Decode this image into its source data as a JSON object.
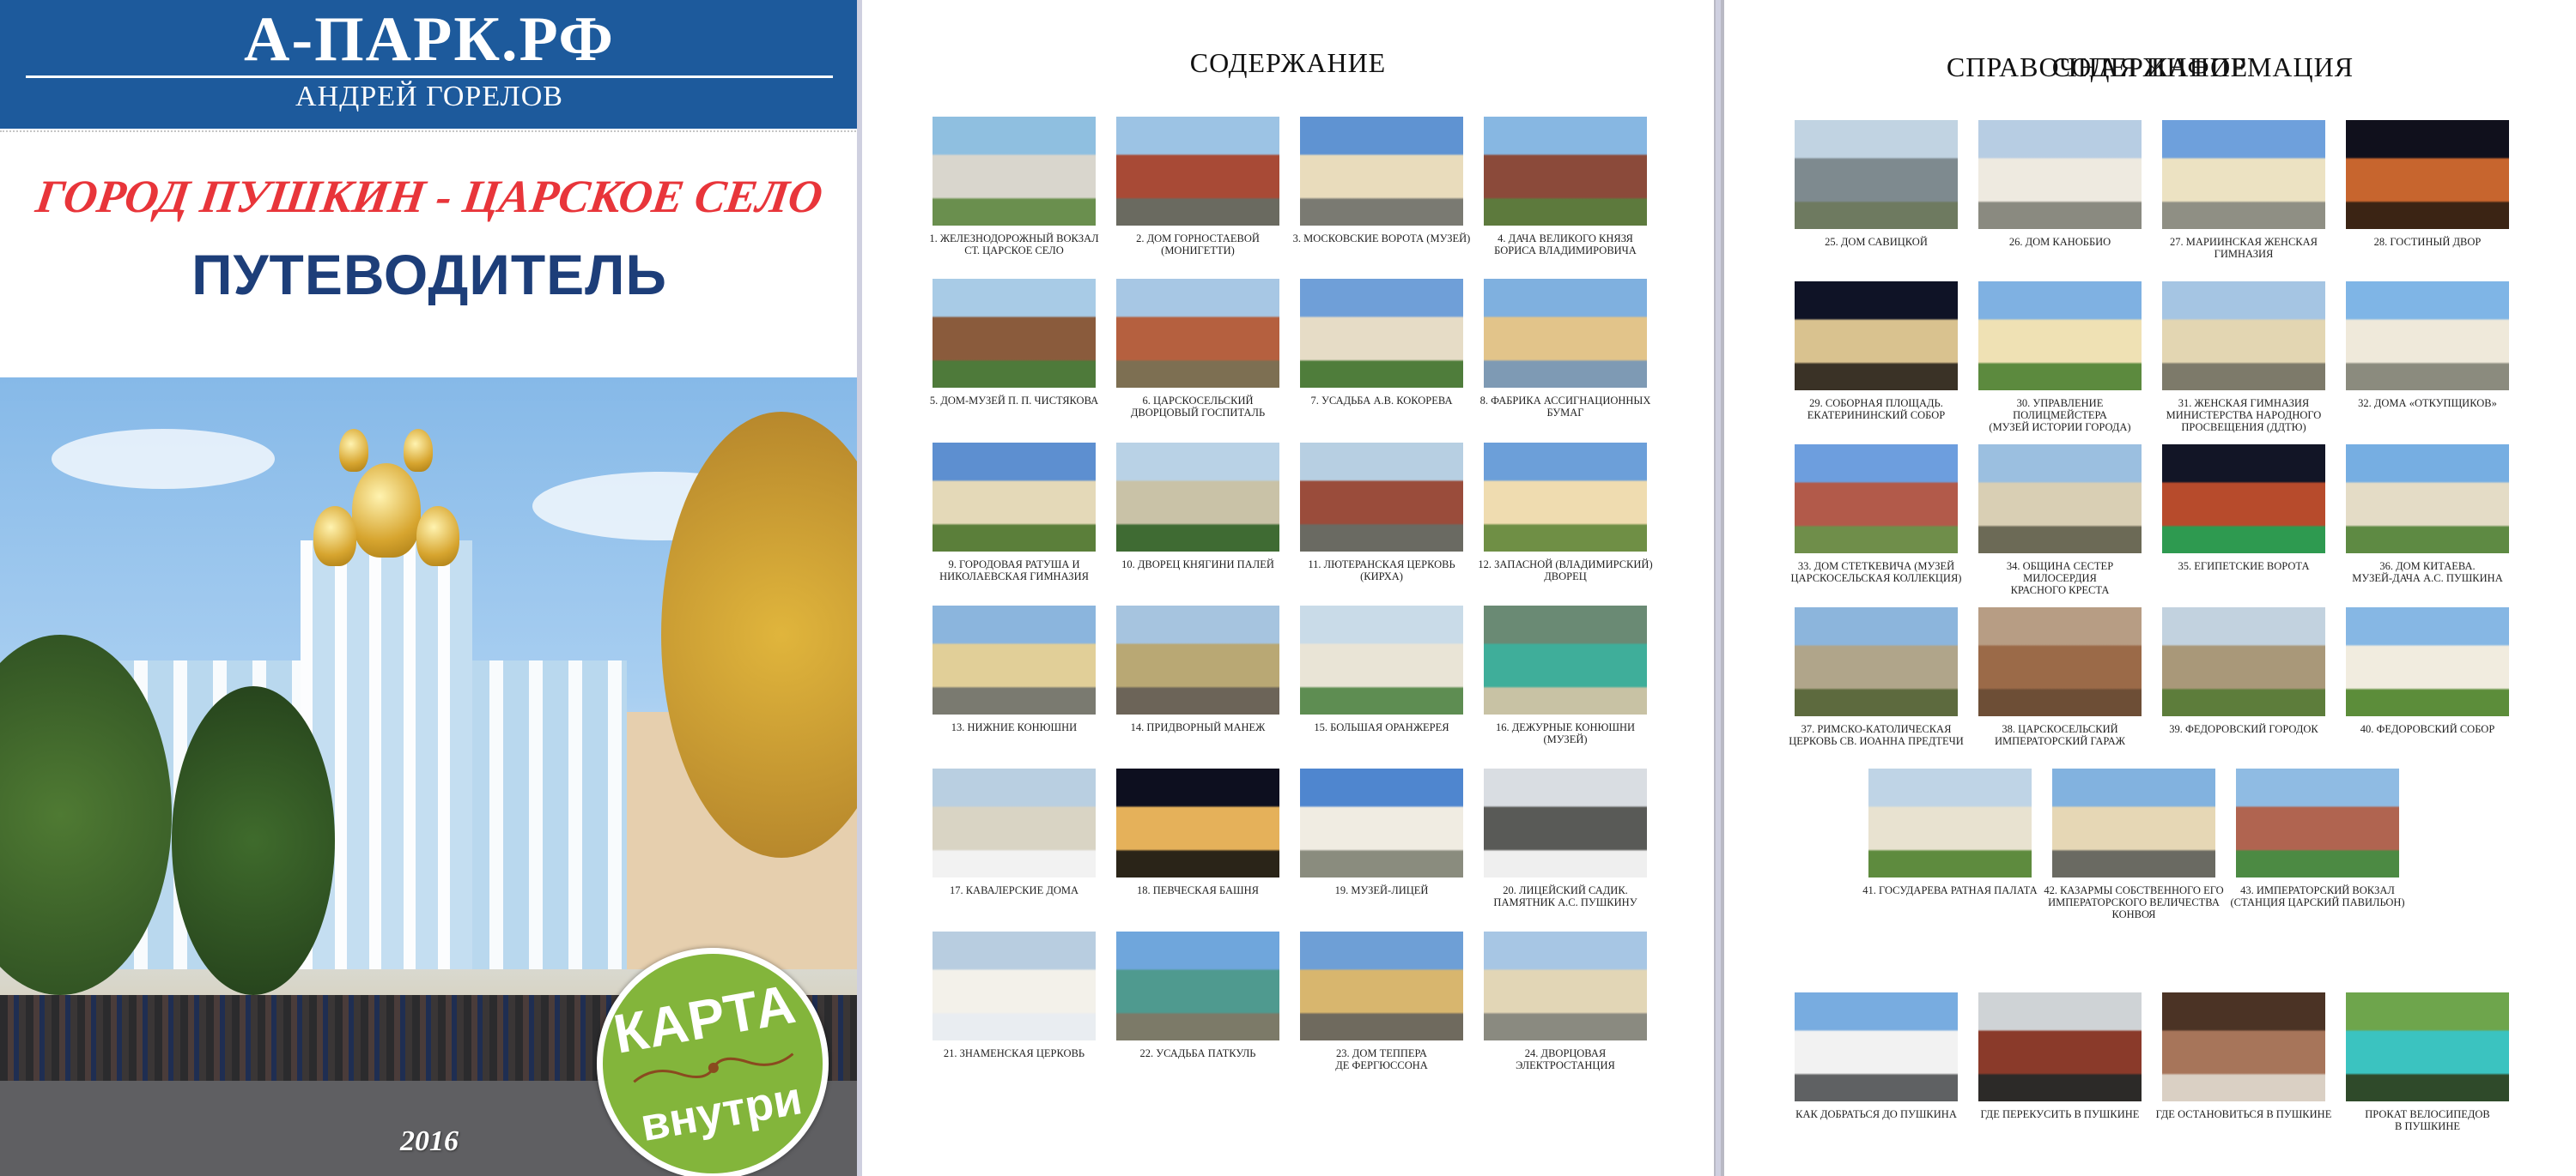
{
  "cover": {
    "site_name": "А-ПАРК.РФ",
    "author": "АНДРЕЙ ГОРЕЛОВ",
    "subtitle": "ГОРОД ПУШКИН - ЦАРСКОЕ СЕЛО",
    "title": "ПУТЕВОДИТЕЛЬ",
    "badge_top": "КАРТА",
    "badge_bottom": "внутри",
    "year": "2016"
  },
  "contents_title": "СОДЕРЖАНИЕ",
  "reference_title": "СПРАВОЧНАЯ ИНФОРМАЦИЯ",
  "page1_items": [
    {
      "caption": "1. ЖЕЛЕЗНОДОРОЖНЫЙ ВОКЗАЛ\nСТ. ЦАРСКОЕ СЕЛО",
      "colors": [
        "#8fbfe0",
        "#d9d6cd",
        "#6a8f4e"
      ]
    },
    {
      "caption": "2. ДОМ ГОРНОСТАЕВОЙ\n(МОНИГЕТТИ)",
      "colors": [
        "#9cc3e4",
        "#a84a36",
        "#6a6a60"
      ]
    },
    {
      "caption": "3. МОСКОВСКИЕ ВОРОТА (МУЗЕЙ)",
      "colors": [
        "#5f93d2",
        "#e9dcbc",
        "#7a7a72"
      ]
    },
    {
      "caption": "4. ДАЧА ВЕЛИКОГО КНЯЗЯ\nБОРИСА ВЛАДИМИРОВИЧА",
      "colors": [
        "#87b7e2",
        "#8b4a3a",
        "#5d7a3d"
      ]
    },
    {
      "caption": "5. ДОМ-МУЗЕЙ П. П. ЧИСТЯКОВА",
      "colors": [
        "#a8cbe6",
        "#8a5b3c",
        "#4e7a3a"
      ]
    },
    {
      "caption": "6. ЦАРСКОСЕЛЬСКИЙ\nДВОРЦОВЫЙ ГОСПИТАЛЬ",
      "colors": [
        "#a7c7e4",
        "#b5603f",
        "#7d6f52"
      ]
    },
    {
      "caption": "7. УСАДЬБА А.В. КОКОРЕВА",
      "colors": [
        "#6f9fd8",
        "#e6dcc6",
        "#4f7d3b"
      ]
    },
    {
      "caption": "8. ФАБРИКА АССИГНАЦИОННЫХ\nБУМАГ",
      "colors": [
        "#7fb0df",
        "#e2c48a",
        "#7e9ab4"
      ]
    },
    {
      "caption": "9. ГОРОДОВАЯ РАТУША И\nНИКОЛАЕВСКАЯ ГИМНАЗИЯ",
      "colors": [
        "#5d8fd0",
        "#e4d9b8",
        "#5b7f3a"
      ]
    },
    {
      "caption": "10. ДВОРЕЦ КНЯГИНИ ПАЛЕЙ",
      "colors": [
        "#b9d2e6",
        "#c9c2a7",
        "#3f6b33"
      ]
    },
    {
      "caption": "11. ЛЮТЕРАНСКАЯ ЦЕРКОВЬ\n(КИРХА)",
      "colors": [
        "#b7cfe2",
        "#9a4c3b",
        "#6a6a62"
      ]
    },
    {
      "caption": "12. ЗАПАСНОЙ (ВЛАДИМИРСКИЙ)\nДВОРЕЦ",
      "colors": [
        "#6c9fd9",
        "#efdcb0",
        "#6f8f45"
      ]
    },
    {
      "caption": "13. НИЖНИЕ КОНЮШНИ",
      "colors": [
        "#8bb5dd",
        "#e1cf98",
        "#7a7a70"
      ]
    },
    {
      "caption": "14. ПРИДВОРНЫЙ МАНЕЖ",
      "colors": [
        "#a6c4df",
        "#b9a874",
        "#6c6458"
      ]
    },
    {
      "caption": "15. БОЛЬШАЯ ОРАНЖЕРЕЯ",
      "colors": [
        "#c9dbe8",
        "#e9e4d6",
        "#5e8d52"
      ]
    },
    {
      "caption": "16. ДЕЖУРНЫЕ КОНЮШНИ\n(МУЗЕЙ)",
      "colors": [
        "#6a8a74",
        "#3fae9a",
        "#c8c2a4"
      ]
    },
    {
      "caption": "17. КАВАЛЕРСКИЕ ДОМА",
      "colors": [
        "#b9cfe1",
        "#d9d4c4",
        "#f2f2f2"
      ]
    },
    {
      "caption": "18. ПЕВЧЕСКАЯ БАШНЯ",
      "colors": [
        "#0d0f1f",
        "#e5b15a",
        "#2a2418"
      ]
    },
    {
      "caption": "19. МУЗЕЙ-ЛИЦЕЙ",
      "colors": [
        "#4f86cf",
        "#f0ece2",
        "#8a8c7e"
      ]
    },
    {
      "caption": "20. ЛИЦЕЙСКИЙ САДИК.\nПАМЯТНИК А.С. ПУШКИНУ",
      "colors": [
        "#d9dde2",
        "#595a57",
        "#efefef"
      ]
    },
    {
      "caption": "21. ЗНАМЕНСКАЯ ЦЕРКОВЬ",
      "colors": [
        "#b8cde0",
        "#f3f1ea",
        "#e9edf1"
      ]
    },
    {
      "caption": "22. УСАДЬБА ПАТКУЛЬ",
      "colors": [
        "#6fa6dc",
        "#4f9a8f",
        "#7c7a68"
      ]
    },
    {
      "caption": "23. ДОМ ТЕППЕРА\nДЕ ФЕРГЮССОНА",
      "colors": [
        "#6e9fd6",
        "#d8b66e",
        "#6f6a5e"
      ]
    },
    {
      "caption": "24. ДВОРЦОВАЯ ЭЛЕКТРОСТАНЦИЯ",
      "colors": [
        "#a7c6e4",
        "#e2d6b6",
        "#8a8a80"
      ]
    }
  ],
  "page2_items": [
    {
      "caption": "25. ДОМ САВИЦКОЙ",
      "colors": [
        "#c1d3e2",
        "#7e8a8f",
        "#6e7a60"
      ]
    },
    {
      "caption": "26. ДОМ КАНОББИО",
      "colors": [
        "#b7cde3",
        "#eeeae0",
        "#8a8a80"
      ]
    },
    {
      "caption": "27. МАРИИНСКАЯ ЖЕНСКАЯ\nГИМНАЗИЯ",
      "colors": [
        "#6ea0dc",
        "#ece2c2",
        "#8f8f84"
      ]
    },
    {
      "caption": "28. ГОСТИНЫЙ ДВОР",
      "colors": [
        "#10101c",
        "#c7652e",
        "#3b2414"
      ]
    },
    {
      "caption": "29. СОБОРНАЯ ПЛОЩАДЬ.\nЕКАТЕРИНИНСКИЙ СОБОР",
      "colors": [
        "#0f1326",
        "#d9c28f",
        "#3a3226"
      ]
    },
    {
      "caption": "30. УПРАВЛЕНИЕ\nПОЛИЦМЕЙСТЕРА\n(МУЗЕЙ ИСТОРИИ ГОРОДА)",
      "colors": [
        "#7fb1e2",
        "#efe1b4",
        "#5c8a3e"
      ]
    },
    {
      "caption": "31. ЖЕНСКАЯ ГИМНАЗИЯ\nМИНИСТЕРСТВА НАРОДНОГО\nПРОСВЕЩЕНИЯ (ДДТЮ)",
      "colors": [
        "#a5c5e3",
        "#e3d6b2",
        "#7d7a6a"
      ]
    },
    {
      "caption": "32. ДОМА «ОТКУПЩИКОВ»",
      "colors": [
        "#7fb5e6",
        "#efe9da",
        "#8b8b7e"
      ]
    },
    {
      "caption": "33. ДОМ СТЕТКЕВИЧА (МУЗЕЙ\nЦАРСКОСЕЛЬСКАЯ КОЛЛЕКЦИЯ)",
      "colors": [
        "#6d9ede",
        "#b25a4a",
        "#6f8e4a"
      ]
    },
    {
      "caption": "34. ОБЩИНА СЕСТЕР МИЛОСЕРДИЯ\nКРАСНОГО КРЕСТА",
      "colors": [
        "#9bbfe0",
        "#d9cfb4",
        "#6c6a56"
      ]
    },
    {
      "caption": "35. ЕГИПЕТСКИЕ ВОРОТА",
      "colors": [
        "#121526",
        "#b74b2c",
        "#2e9a50"
      ]
    },
    {
      "caption": "36. ДОМ КИТАЕВА.\nМУЗЕЙ-ДАЧА А.С. ПУШКИНА",
      "colors": [
        "#76aee2",
        "#e4dcc6",
        "#5e8a43"
      ]
    },
    {
      "caption": "37. РИМСКО-КАТОЛИЧЕСКАЯ\nЦЕРКОВЬ СВ. ИОАННА ПРЕДТЕЧИ",
      "colors": [
        "#8cb5dc",
        "#b0a58a",
        "#5d6a3e"
      ]
    },
    {
      "caption": "38. ЦАРСКОСЕЛЬСКИЙ\nИМПЕРАТОРСКИЙ ГАРАЖ",
      "colors": [
        "#b79d84",
        "#9b6a48",
        "#6d4e36"
      ]
    },
    {
      "caption": "39. ФЕДОРОВСКИЙ ГОРОДОК",
      "colors": [
        "#c2d2df",
        "#a99879",
        "#5d7d3b"
      ]
    },
    {
      "caption": "40. ФЕДОРОВСКИЙ СОБОР",
      "colors": [
        "#86b7e4",
        "#f1ecdf",
        "#5c8d3a"
      ]
    },
    {
      "caption": "41. ГОСУДАРЕВА РАТНАЯ ПАЛАТА",
      "colors": [
        "#bfd4e6",
        "#e8e2d0",
        "#5e8b3e"
      ]
    },
    {
      "caption": "42. КАЗАРМЫ СОБСТВЕННОГО ЕГО\nИМПЕРАТОРСКОГО ВЕЛИЧЕСТВА\nКОНВОЯ",
      "colors": [
        "#82b2df",
        "#e6d7b5",
        "#6a6a62"
      ]
    },
    {
      "caption": "43. ИМПЕРАТОРСКИЙ ВОКЗАЛ\n(СТАНЦИЯ ЦАРСКИЙ ПАВИЛЬОН)",
      "colors": [
        "#8fbbe3",
        "#b06450",
        "#4c8a43"
      ]
    }
  ],
  "reference_items": [
    {
      "caption": "КАК ДОБРАТЬСЯ ДО ПУШКИНА",
      "colors": [
        "#78ace0",
        "#f2f2f2",
        "#5f6163"
      ]
    },
    {
      "caption": "ГДЕ ПЕРЕКУСИТЬ В ПУШКИНЕ",
      "colors": [
        "#cfd3d6",
        "#8a3a2a",
        "#2c2a28"
      ]
    },
    {
      "caption": "ГДЕ ОСТАНОВИТЬСЯ В ПУШКИНЕ",
      "colors": [
        "#4b3325",
        "#a7755a",
        "#dad0c4"
      ]
    },
    {
      "caption": "ПРОКАТ ВЕЛОСИПЕДОВ\nВ ПУШКИНЕ",
      "colors": [
        "#6ea54c",
        "#3bc3c0",
        "#2f4a2a"
      ]
    }
  ]
}
